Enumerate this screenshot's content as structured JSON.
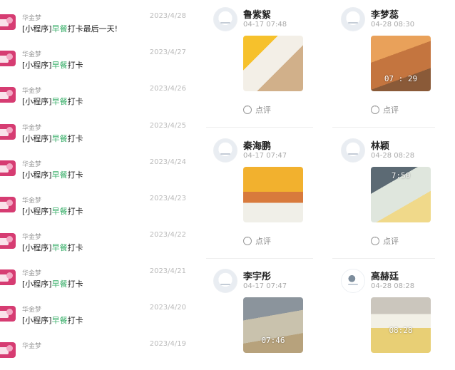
{
  "messages": [
    {
      "sender": "华金梦",
      "time": "2023/4/28",
      "prefix": "[小程序]",
      "highlight": "早餐",
      "suffix": "打卡最后一天!"
    },
    {
      "sender": "华金梦",
      "time": "2023/4/27",
      "prefix": "[小程序]",
      "highlight": "早餐",
      "suffix": "打卡"
    },
    {
      "sender": "华金梦",
      "time": "2023/4/26",
      "prefix": "[小程序]",
      "highlight": "早餐",
      "suffix": "打卡"
    },
    {
      "sender": "华金梦",
      "time": "2023/4/25",
      "prefix": "[小程序]",
      "highlight": "早餐",
      "suffix": "打卡"
    },
    {
      "sender": "华金梦",
      "time": "2023/4/24",
      "prefix": "[小程序]",
      "highlight": "早餐",
      "suffix": "打卡"
    },
    {
      "sender": "华金梦",
      "time": "2023/4/23",
      "prefix": "[小程序]",
      "highlight": "早餐",
      "suffix": "打卡"
    },
    {
      "sender": "华金梦",
      "time": "2023/4/22",
      "prefix": "[小程序]",
      "highlight": "早餐",
      "suffix": "打卡"
    },
    {
      "sender": "华金梦",
      "time": "2023/4/21",
      "prefix": "[小程序]",
      "highlight": "早餐",
      "suffix": "打卡"
    },
    {
      "sender": "华金梦",
      "time": "2023/4/20",
      "prefix": "[小程序]",
      "highlight": "早餐",
      "suffix": "打卡"
    },
    {
      "sender": "华金梦",
      "time": "2023/4/19",
      "prefix": "",
      "highlight": "",
      "suffix": ""
    }
  ],
  "posts": [
    {
      "name": "鲁紫絮",
      "time": "04-17 07:48",
      "stamp": "",
      "comment": "点评"
    },
    {
      "name": "李梦蕊",
      "time": "04-28 08:30",
      "stamp": "07 : 29",
      "comment": "点评"
    },
    {
      "name": "秦海鹏",
      "time": "04-17 07:47",
      "stamp": "",
      "comment": "点评"
    },
    {
      "name": "林颖",
      "time": "04-28 08:28",
      "stamp": "7:50",
      "comment": "点评"
    },
    {
      "name": "李宇彤",
      "time": "04-17 07:47",
      "stamp": "07:46",
      "comment": ""
    },
    {
      "name": "高赫廷",
      "time": "04-28 08:28",
      "stamp": "08:28",
      "comment": ""
    }
  ],
  "colors": {
    "highlight": "#3aaf6a",
    "avatar": "#d63c72"
  },
  "icons": [
    "app-avatar-icon",
    "comment-icon",
    "user-avatar-icon"
  ]
}
